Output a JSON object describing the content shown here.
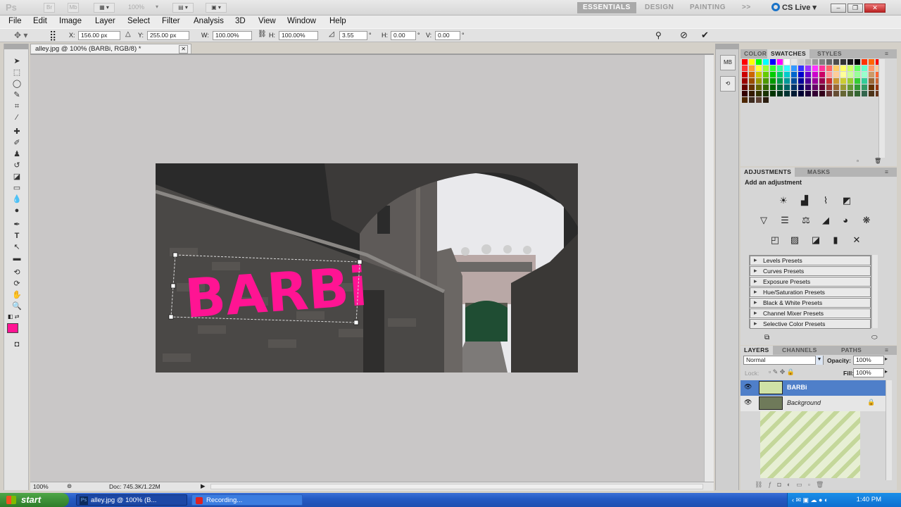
{
  "app": {
    "logo": "Ps",
    "bridge_btn": "Br",
    "mini_btn": "Mb",
    "zoom_value": "100%",
    "workspaces": [
      "ESSENTIALS",
      "DESIGN",
      "PAINTING"
    ],
    "workspace_more": ">>",
    "cs_live": "CS Live",
    "window_controls": [
      "–",
      "❐",
      "✕"
    ]
  },
  "menubar": [
    "File",
    "Edit",
    "Image",
    "Layer",
    "Select",
    "Filter",
    "Analysis",
    "3D",
    "View",
    "Window",
    "Help"
  ],
  "options": {
    "x_label": "X:",
    "x_value": "156.00 px",
    "y_label": "Y:",
    "y_value": "255.00 px",
    "w_label": "W:",
    "w_value": "100.00%",
    "h_label": "H:",
    "h_value": "100.00%",
    "angle_value": "3.55",
    "hskew_label": "H:",
    "hskew_value": "0.00",
    "vskew_label": "V:",
    "vskew_value": "0.00"
  },
  "document": {
    "tab_title": "alley.jpg @ 100% (BARBi, RGB/8) *",
    "tab_close": "✕",
    "graffiti_text": "BARBi",
    "status_zoom": "100%",
    "status_doc": "Doc: 745.3K/1.22M"
  },
  "color_panel": {
    "tabs": [
      "COLOR",
      "SWATCHES",
      "STYLES"
    ],
    "active_tab": "SWATCHES",
    "foreground_color": "#ff1493"
  },
  "adjustments_panel": {
    "tabs": [
      "ADJUSTMENTS",
      "MASKS"
    ],
    "heading": "Add an adjustment",
    "presets": [
      "Levels Presets",
      "Curves Presets",
      "Exposure Presets",
      "Hue/Saturation Presets",
      "Black & White Presets",
      "Channel Mixer Presets",
      "Selective Color Presets"
    ]
  },
  "layers_panel": {
    "tabs": [
      "LAYERS",
      "CHANNELS",
      "PATHS"
    ],
    "blend_mode": "Normal",
    "opacity_label": "Opacity:",
    "opacity_value": "100%",
    "lock_label": "Lock:",
    "fill_label": "Fill:",
    "fill_value": "100%",
    "layers": [
      {
        "name": "BARBi",
        "selected": true
      },
      {
        "name": "Background",
        "selected": false
      }
    ]
  },
  "taskbar": {
    "start": "start",
    "tasks": [
      "alley.jpg @ 100% (B...",
      "Recording..."
    ],
    "clock": "1:40 PM"
  }
}
